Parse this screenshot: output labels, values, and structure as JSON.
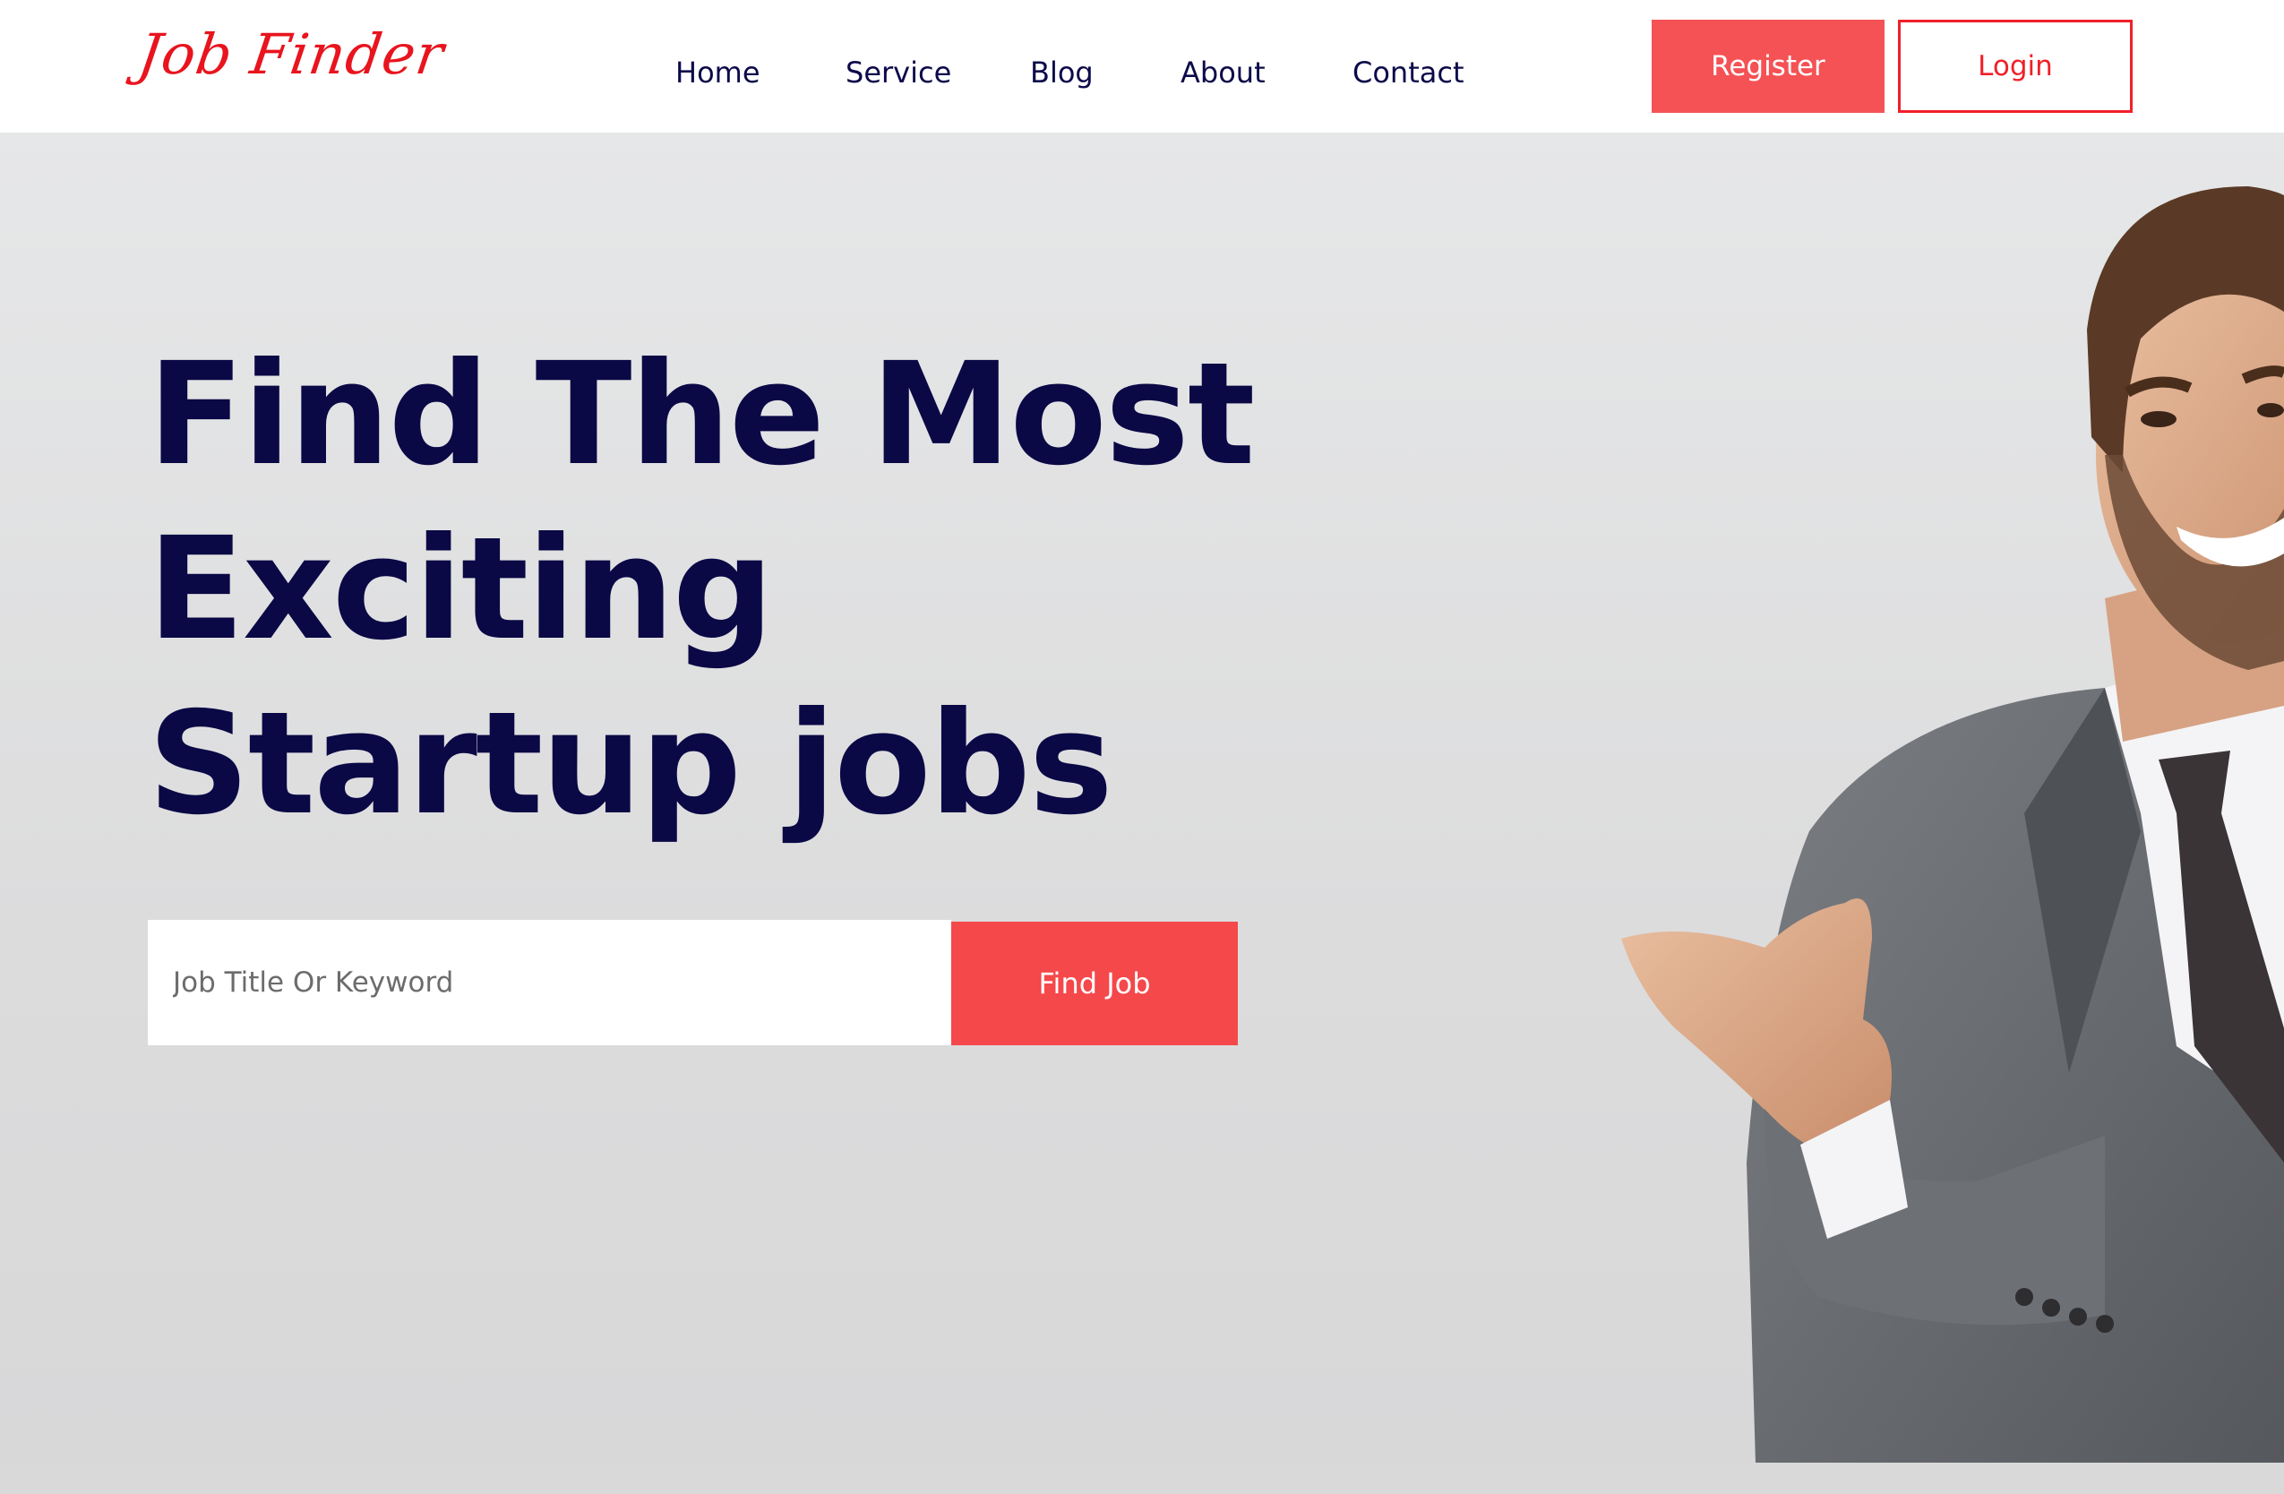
{
  "header": {
    "logo": "Job Finder",
    "nav": [
      {
        "label": "Home"
      },
      {
        "label": "Service"
      },
      {
        "label": "Blog"
      },
      {
        "label": "About"
      },
      {
        "label": "Contact"
      }
    ],
    "register_label": "Register",
    "login_label": "Login"
  },
  "hero": {
    "title_lines": [
      "Find The Most",
      "Exciting",
      "Startup jobs"
    ],
    "search": {
      "placeholder": "Job Title Or Keyword",
      "value": ""
    },
    "find_button_label": "Find Job"
  },
  "colors": {
    "accent": "#f4484b",
    "brand_logo": "#e8141e",
    "heading": "#0a0845",
    "nav_text": "#0c0a4a"
  }
}
